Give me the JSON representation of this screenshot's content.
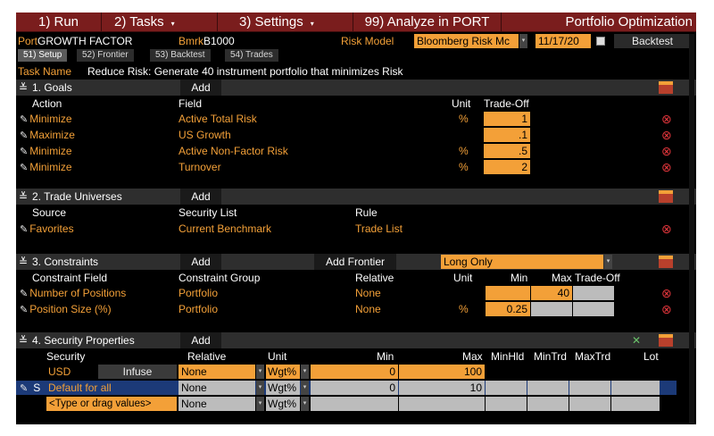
{
  "menu": {
    "run": "1) Run",
    "tasks": "2) Tasks",
    "settings": "3) Settings",
    "analyze": "99) Analyze in PORT",
    "title": "Portfolio Optimization"
  },
  "header": {
    "port_label": "Port",
    "port_value": "GROWTH FACTOR",
    "bmrk_label": "Bmrk",
    "bmrk_value": "B1000",
    "risk_model_label": "Risk Model",
    "risk_model_value": "Bloomberg Risk Mc",
    "date_value": "11/17/20",
    "backtest_button": "Backtest"
  },
  "tabs": [
    "51) Setup",
    "52) Frontier",
    "53) Backtest",
    "54) Trades"
  ],
  "task": {
    "label": "Task Name",
    "value": "Reduce Risk: Generate 40 instrument portfolio that minimizes Risk"
  },
  "goals": {
    "title": "1. Goals",
    "add": "Add",
    "headers": {
      "action": "Action",
      "field": "Field",
      "unit": "Unit",
      "tradeoff": "Trade-Off"
    },
    "rows": [
      {
        "action": "Minimize",
        "field": "Active Total Risk",
        "unit": "%",
        "tradeoff": "1"
      },
      {
        "action": "Maximize",
        "field": "US Growth",
        "unit": "",
        "tradeoff": ".1"
      },
      {
        "action": "Minimize",
        "field": "Active Non-Factor Risk",
        "unit": "%",
        "tradeoff": ".5"
      },
      {
        "action": "Minimize",
        "field": "Turnover",
        "unit": "%",
        "tradeoff": "2"
      }
    ]
  },
  "universes": {
    "title": "2. Trade Universes",
    "add": "Add",
    "headers": {
      "source": "Source",
      "list": "Security List",
      "rule": "Rule"
    },
    "rows": [
      {
        "source": "Favorites",
        "list": "Current Benchmark",
        "rule": "Trade List"
      }
    ]
  },
  "constraints": {
    "title": "3. Constraints",
    "add": "Add",
    "add_frontier": "Add Frontier",
    "mode": "Long Only",
    "headers": {
      "field": "Constraint Field",
      "group": "Constraint Group",
      "relative": "Relative",
      "unit": "Unit",
      "min": "Min",
      "max": "Max",
      "tradeoff": "Trade-Off"
    },
    "rows": [
      {
        "field": "Number of Positions",
        "group": "Portfolio",
        "relative": "None",
        "unit": "",
        "min": "",
        "max": "40",
        "tradeoff": ""
      },
      {
        "field": "Position Size (%)",
        "group": "Portfolio",
        "relative": "None",
        "unit": "%",
        "min": "0.25",
        "max": "",
        "tradeoff": ""
      }
    ]
  },
  "properties": {
    "title": "4. Security Properties",
    "add": "Add",
    "headers": {
      "security": "Security",
      "relative": "Relative",
      "unit": "Unit",
      "min": "Min",
      "max": "Max",
      "minhld": "MinHld",
      "mintrd": "MinTrd",
      "maxtrd": "MaxTrd",
      "lot": "Lot"
    },
    "rows": [
      {
        "security": "USD",
        "infuse": "Infuse",
        "relative": "None",
        "unit": "Wgt%",
        "min": "0",
        "max": "100"
      },
      {
        "prefix": "S",
        "security": "Default for all",
        "relative": "None",
        "unit": "Wgt%",
        "min": "0",
        "max": "10"
      },
      {
        "security": "<Type or drag values>",
        "relative": "None",
        "unit": "Wgt%",
        "min": "",
        "max": ""
      }
    ]
  },
  "colors": {
    "accent": "#f3a038",
    "menu_bg": "#7a1d1d",
    "delete": "#e0353b",
    "selected_row": "#1c3a78"
  }
}
